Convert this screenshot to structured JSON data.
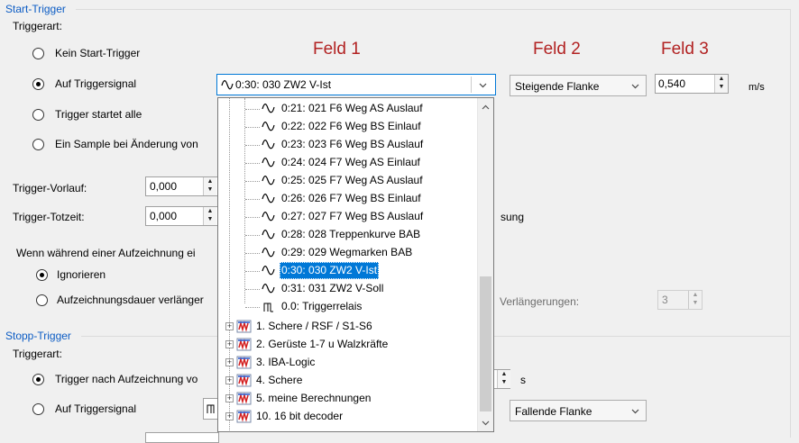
{
  "start_trigger": {
    "group_title": "Start-Trigger",
    "trigger_type_label": "Triggerart:",
    "options": [
      "Kein Start-Trigger",
      "Auf Triggersignal",
      "Trigger startet alle",
      "Ein Sample bei Änderung von"
    ],
    "selected_option": "Auf Triggersignal",
    "selected_signal": "0:30: 030 ZW2 V-Ist",
    "edge_value": "Steigende Flanke",
    "level_value": "0,540",
    "level_unit": "m/s",
    "pretrigger_label": "Trigger-Vorlauf:",
    "pretrigger_value": "0,000",
    "deadtime_label": "Trigger-Totzeit:",
    "deadtime_value": "0,000",
    "deadtime_suffix_fragment": "sung",
    "during_recording_label": "Wenn während einer Aufzeichnung ei",
    "ignore_label": "Ignorieren",
    "extend_label": "Aufzeichnungsdauer verlänger",
    "extensions_label": "Verlängerungen:",
    "extensions_value": "3"
  },
  "field_headers": {
    "f1": "Feld 1",
    "f2": "Feld 2",
    "f3": "Feld 3"
  },
  "dropdown": {
    "signals": [
      "0:21: 021 F6 Weg AS Auslauf",
      "0:22: 022 F6 Weg BS Einlauf",
      "0:23: 023 F6 Weg BS Auslauf",
      "0:24: 024 F7 Weg AS Einlauf",
      "0:25: 025 F7 Weg AS Auslauf",
      "0:26: 026 F7 Weg BS Einlauf",
      "0:27: 027 F7 Weg BS Auslauf",
      "0:28: 028 Treppenkurve BAB",
      "0:29: 029 Wegmarken BAB",
      "0:30: 030 ZW2 V-Ist",
      "0:31: 031 ZW2 V-Soll"
    ],
    "digital_signal": "0.0: Triggerrelais",
    "modules": [
      "1. Schere / RSF / S1-S6",
      "2. Gerüste 1-7  u   Walzkräfte",
      "3. IBA-Logic",
      "4. Schere",
      "5. meine Berechnungen",
      "10. 16 bit decoder"
    ],
    "selected_index": 9
  },
  "stop_trigger": {
    "group_title": "Stopp-Trigger",
    "trigger_type_label": "Triggerart:",
    "options": [
      "Trigger nach Aufzeichnung vo",
      "Auf Triggersignal"
    ],
    "selected_option": "Trigger nach Aufzeichnung vo",
    "duration_unit": "s",
    "edge_value": "Fallende Flanke"
  },
  "colors": {
    "accent": "#0078d7",
    "group_title": "#0c5cc4",
    "field_header": "#b22222"
  },
  "icons": [
    "analog-signal-icon",
    "digital-signal-icon",
    "module-icon",
    "chevron-down-icon",
    "chevron-up-icon",
    "expand-plus-icon"
  ]
}
